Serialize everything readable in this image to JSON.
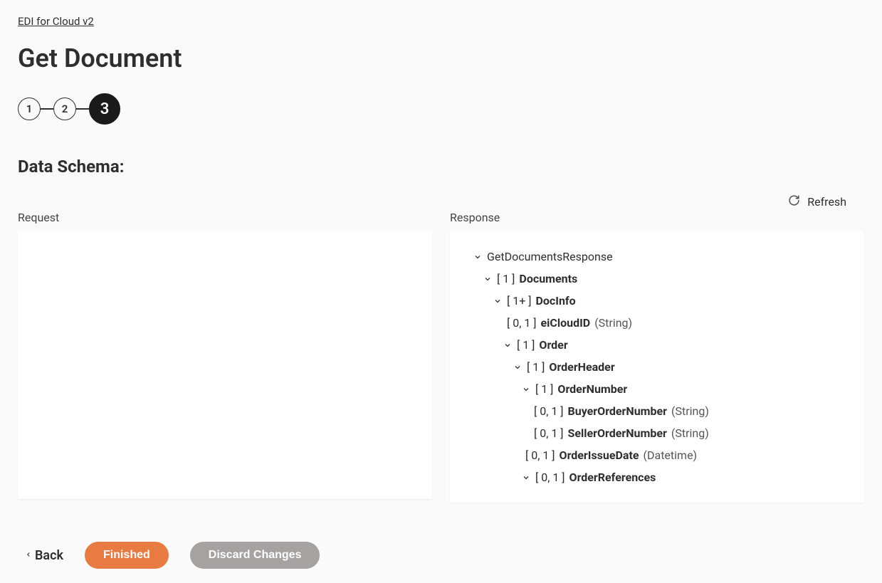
{
  "breadcrumb": "EDI for Cloud v2",
  "page_title": "Get Document",
  "stepper": {
    "steps": [
      "1",
      "2",
      "3"
    ],
    "active_index": 2
  },
  "section_title": "Data Schema:",
  "refresh_label": "Refresh",
  "columns": {
    "request_label": "Request",
    "response_label": "Response"
  },
  "response_tree": {
    "root": {
      "name": "GetDocumentsResponse"
    },
    "documents": {
      "card": "[ 1 ]",
      "name": "Documents"
    },
    "docinfo": {
      "card": "[ 1+ ]",
      "name": "DocInfo"
    },
    "eicloudid": {
      "card": "[ 0, 1 ]",
      "name": "eiCloudID",
      "type": "(String)"
    },
    "order": {
      "card": "[ 1 ]",
      "name": "Order"
    },
    "orderheader": {
      "card": "[ 1 ]",
      "name": "OrderHeader"
    },
    "ordernumber": {
      "card": "[ 1 ]",
      "name": "OrderNumber"
    },
    "buyerorder": {
      "card": "[ 0, 1 ]",
      "name": "BuyerOrderNumber",
      "type": "(String)"
    },
    "sellerorder": {
      "card": "[ 0, 1 ]",
      "name": "SellerOrderNumber",
      "type": "(String)"
    },
    "orderissuedate": {
      "card": "[ 0, 1 ]",
      "name": "OrderIssueDate",
      "type": "(Datetime)"
    },
    "orderreferences": {
      "card": "[ 0, 1 ]",
      "name": "OrderReferences"
    }
  },
  "footer": {
    "back": "Back",
    "finished": "Finished",
    "discard": "Discard Changes"
  }
}
